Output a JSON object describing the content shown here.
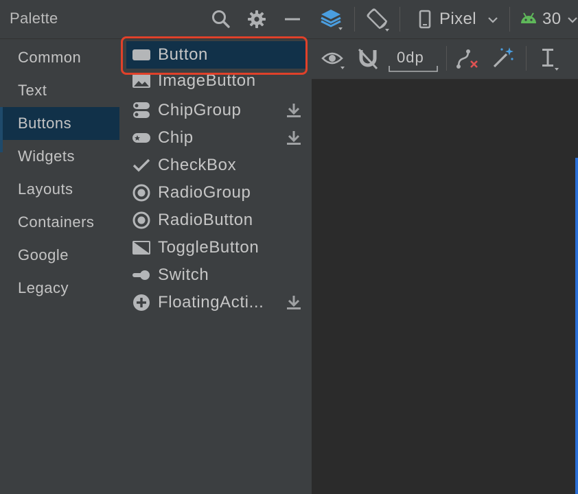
{
  "palette": {
    "title": "Palette",
    "categories": [
      {
        "label": "Common"
      },
      {
        "label": "Text"
      },
      {
        "label": "Buttons"
      },
      {
        "label": "Widgets"
      },
      {
        "label": "Layouts"
      },
      {
        "label": "Containers"
      },
      {
        "label": "Google"
      },
      {
        "label": "Legacy"
      }
    ],
    "selected_category": "Buttons",
    "widgets": [
      {
        "label": "Button",
        "icon": "button-icon",
        "download": false
      },
      {
        "label": "ImageButton",
        "icon": "image-button-icon",
        "download": false
      },
      {
        "label": "ChipGroup",
        "icon": "chip-group-icon",
        "download": true
      },
      {
        "label": "Chip",
        "icon": "chip-icon",
        "download": true
      },
      {
        "label": "CheckBox",
        "icon": "checkmark-icon",
        "download": false
      },
      {
        "label": "RadioGroup",
        "icon": "radio-group-icon",
        "download": false
      },
      {
        "label": "RadioButton",
        "icon": "radio-button-icon",
        "download": false
      },
      {
        "label": "ToggleButton",
        "icon": "toggle-button-icon",
        "download": false
      },
      {
        "label": "Switch",
        "icon": "switch-icon",
        "download": false
      },
      {
        "label": "FloatingActi...",
        "icon": "plus-circle-icon",
        "download": true
      }
    ],
    "selected_widget": "Button"
  },
  "design_toolbar": {
    "device": "Pixel",
    "api_level": "30",
    "default_margin": "0dp"
  },
  "colors": {
    "selection": "#113149",
    "highlight_outline": "#e0412a",
    "layers_icon": "#4a9ee0",
    "android_green": "#5fb85a",
    "error_red": "#e05252",
    "wand_blue": "#4a9ee0"
  }
}
